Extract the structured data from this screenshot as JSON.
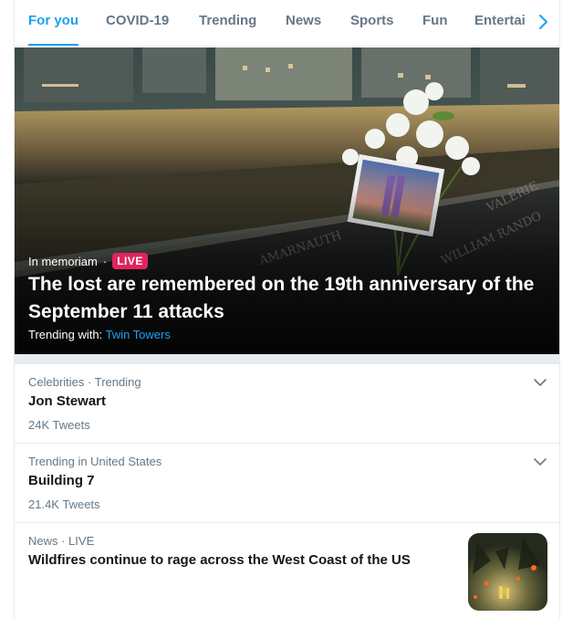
{
  "tabs": [
    {
      "label": "For you",
      "active": true
    },
    {
      "label": "COVID-19",
      "active": false
    },
    {
      "label": "Trending",
      "active": false
    },
    {
      "label": "News",
      "active": false
    },
    {
      "label": "Sports",
      "active": false
    },
    {
      "label": "Fun",
      "active": false
    },
    {
      "label": "Entertai",
      "active": false
    }
  ],
  "tabs_next_icon": "chevron-right-icon",
  "hero": {
    "category": "In memoriam",
    "separator": "·",
    "live_label": "LIVE",
    "title": "The lost are remembered on the 19th anniversary of the September 11 attacks",
    "trending_prefix": "Trending with:",
    "trending_link": "Twin Towers"
  },
  "trends": [
    {
      "meta": "Celebrities · Trending",
      "name": "Jon Stewart",
      "count": "24K Tweets",
      "icon": "chevron-down-icon"
    },
    {
      "meta": "Trending in United States",
      "name": "Building 7",
      "count": "21.4K Tweets",
      "icon": "chevron-down-icon"
    }
  ],
  "news": {
    "meta": "News · LIVE",
    "headline": "Wildfires continue to rage across the West Coast of the US"
  },
  "colors": {
    "accent": "#1da1f2",
    "live": "#e0245e",
    "text": "#14171a",
    "muted": "#657786",
    "border": "#e6ecf0"
  }
}
